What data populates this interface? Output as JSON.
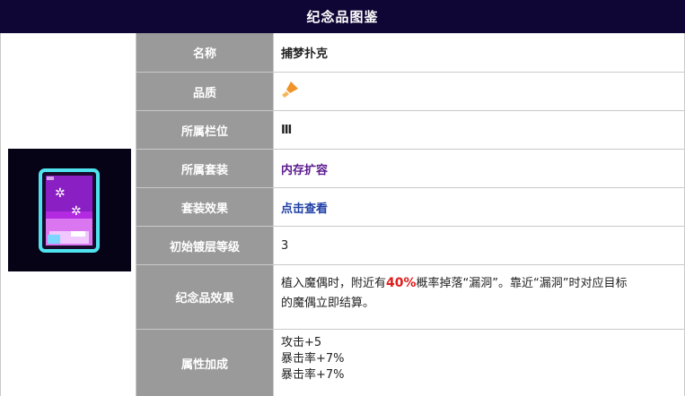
{
  "title": "纪念品图鉴",
  "rows": {
    "name": {
      "label": "名称",
      "value": "捕梦扑克"
    },
    "quality": {
      "label": "品质",
      "icon": "orange-quality-icon",
      "color": "#f0932b"
    },
    "slot": {
      "label": "所属栏位",
      "value": "Ⅲ"
    },
    "set": {
      "label": "所属套装",
      "value": "内存扩容"
    },
    "set_effect": {
      "label": "套装效果",
      "value": "点击查看"
    },
    "plating": {
      "label": "初始镀层等级",
      "value": "3"
    },
    "effect": {
      "label": "纪念品效果",
      "text_before": "植入魔偶时，附近有",
      "highlight": "40%",
      "text_after": "概率掉落“漏洞”。靠近“漏洞”时对应目标",
      "text_line2": "的魔偶立即结算。"
    },
    "stats": {
      "label": "属性加成",
      "lines": [
        "攻击+5",
        "暴击率+7%",
        "暴击率+7%"
      ]
    }
  }
}
